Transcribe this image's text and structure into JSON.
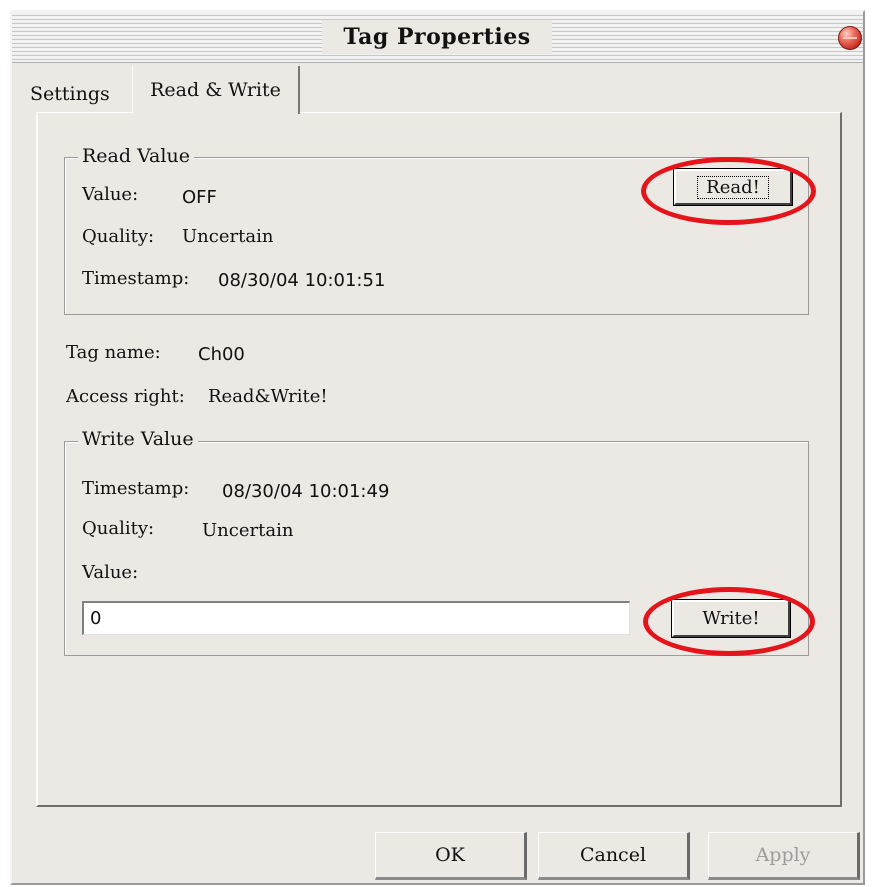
{
  "window": {
    "title": "Tag Properties"
  },
  "tabs": [
    {
      "label": "Settings",
      "active": false
    },
    {
      "label": "Read & Write",
      "active": true
    }
  ],
  "read_group": {
    "legend": "Read Value",
    "value_label": "Value:",
    "value": "OFF",
    "quality_label": "Quality:",
    "quality": "Uncertain",
    "timestamp_label": "Timestamp:",
    "timestamp": "08/30/04 10:01:51",
    "read_button": "Read!"
  },
  "tag": {
    "name_label": "Tag name:",
    "name": "Ch00",
    "access_label": "Access right:",
    "access": "Read&Write!"
  },
  "write_group": {
    "legend": "Write Value",
    "timestamp_label": "Timestamp:",
    "timestamp": "08/30/04 10:01:49",
    "quality_label": "Quality:",
    "quality": "Uncertain",
    "value_label": "Value:",
    "value_input": "0",
    "write_button": "Write!"
  },
  "footer": {
    "ok": "OK",
    "cancel": "Cancel",
    "apply": "Apply"
  },
  "colors": {
    "annotation": "#e5141a",
    "close_button": "#d03a2e"
  }
}
